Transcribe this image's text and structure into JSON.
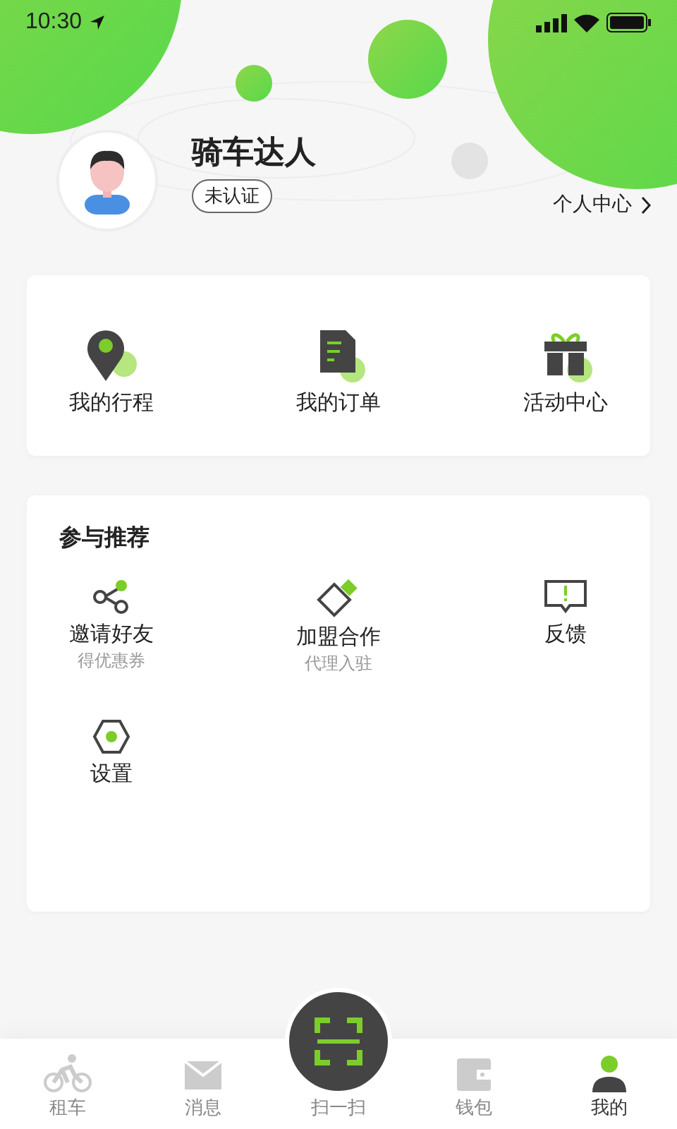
{
  "status_bar": {
    "time": "10:30"
  },
  "profile": {
    "name": "骑车达人",
    "badge": "未认证",
    "link": "个人中心"
  },
  "quick_actions": [
    {
      "label": "我的行程"
    },
    {
      "label": "我的订单"
    },
    {
      "label": "活动中心"
    }
  ],
  "recommend": {
    "title": "参与推荐",
    "items": [
      {
        "label": "邀请好友",
        "sublabel": "得优惠券"
      },
      {
        "label": "加盟合作",
        "sublabel": "代理入驻"
      },
      {
        "label": "反馈"
      },
      {
        "label": "设置"
      }
    ]
  },
  "tabs": [
    {
      "label": "租车",
      "kind": "tab",
      "selected": false
    },
    {
      "label": "消息",
      "kind": "tab",
      "selected": false
    },
    {
      "label": "扫一扫",
      "kind": "scan",
      "selected": false
    },
    {
      "label": "钱包",
      "kind": "tab",
      "selected": false
    },
    {
      "label": "我的",
      "kind": "tab",
      "selected": true
    }
  ]
}
